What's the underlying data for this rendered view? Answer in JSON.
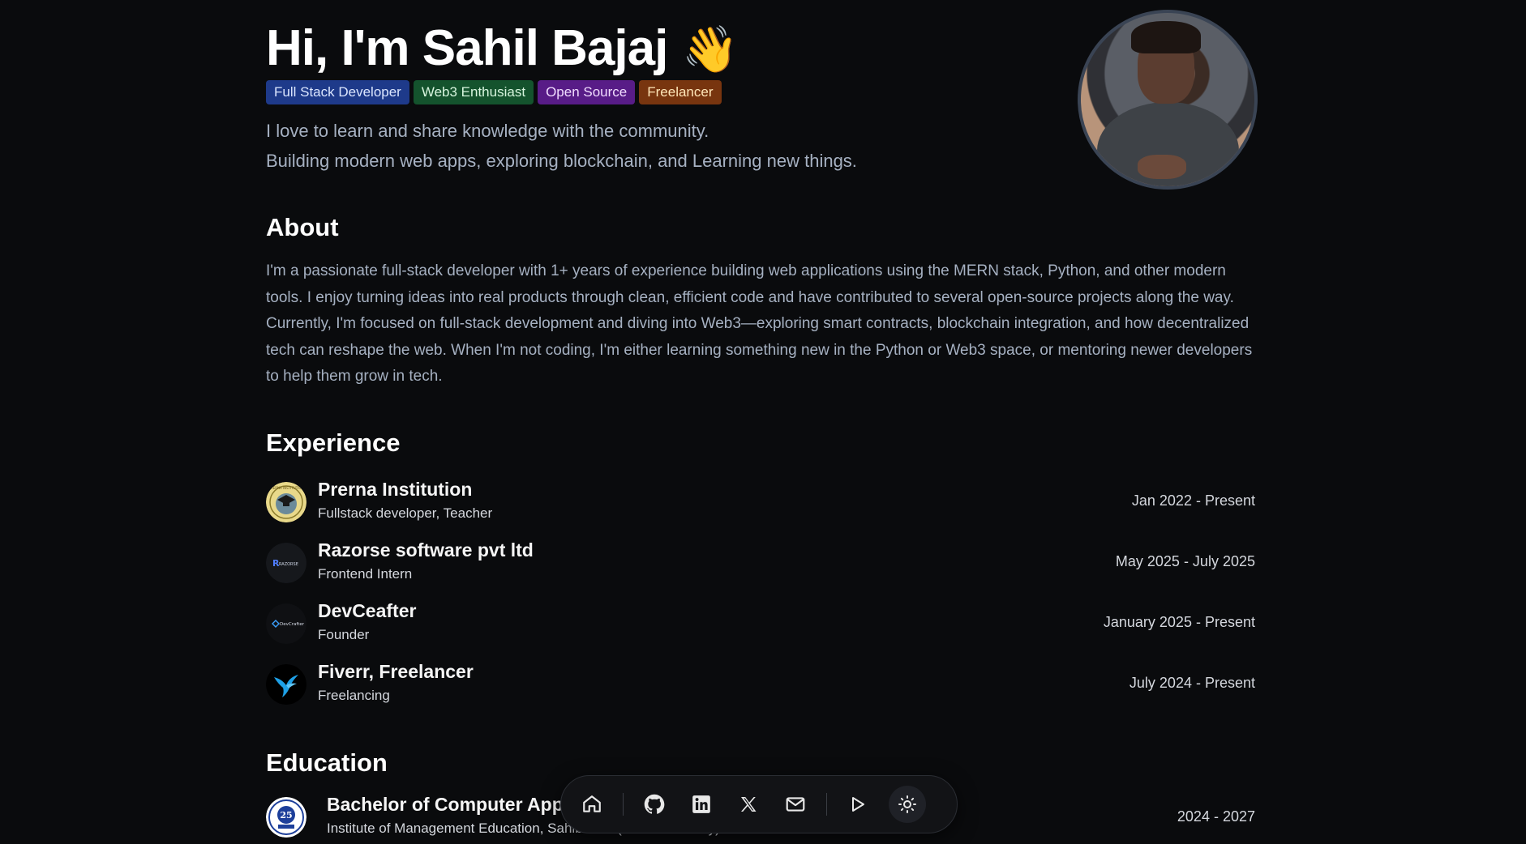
{
  "hero": {
    "title": "Hi, I'm Sahil Bajaj",
    "wave_emoji": "👋",
    "tags": [
      {
        "label": "Full Stack Developer",
        "color": "#1e3a8a"
      },
      {
        "label": "Web3 Enthusiast",
        "color": "#14532d"
      },
      {
        "label": "Open Source",
        "color": "#581c87"
      },
      {
        "label": "Freelancer",
        "color": "#78350f"
      }
    ],
    "bio_lines": [
      "I love to learn and share knowledge with the community.",
      "Building modern web apps, exploring blockchain, and Learning new things."
    ]
  },
  "about": {
    "title": "About",
    "text": "I'm a passionate full-stack developer with 1+ years of experience building web applications using the MERN stack, Python, and other modern tools. I enjoy turning ideas into real products through clean, efficient code and have contributed to several open-source projects along the way. Currently, I'm focused on full-stack development and diving into Web3—exploring smart contracts, blockchain integration, and how decentralized tech can reshape the web. When I'm not coding, I'm either learning something new in the Python or Web3 space, or mentoring newer developers to help them grow in tech."
  },
  "experience": {
    "title": "Experience",
    "items": [
      {
        "company": "Prerna Institution",
        "role": "Fullstack developer, Teacher",
        "dates": "Jan 2022 - Present",
        "logo_text": "PRERNA INSTITUTION"
      },
      {
        "company": "Razorse software pvt ltd",
        "role": "Frontend Intern",
        "dates": "May 2025 - July 2025",
        "logo_text": "RAZORSE"
      },
      {
        "company": "DevCeafter",
        "role": "Founder",
        "dates": "January 2025 - Present",
        "logo_text": "DevCrafter"
      },
      {
        "company": "Fiverr, Freelancer",
        "role": "Freelancing",
        "dates": "July 2024 - Present",
        "logo_text": ""
      }
    ]
  },
  "education": {
    "title": "Education",
    "items": [
      {
        "degree": "Bachelor of Computer Applications",
        "institution": "Institute of Management Education, Sahibabad (CCS University)",
        "dates": "2024 - 2027",
        "logo_text": "25"
      }
    ]
  },
  "dock": {
    "icons": [
      "home-icon",
      "github-icon",
      "linkedin-icon",
      "x-icon",
      "mail-icon",
      "play-icon",
      "sun-icon"
    ]
  },
  "colors": {
    "background": "#0a0b0d",
    "muted_text": "#a6b1c2"
  }
}
